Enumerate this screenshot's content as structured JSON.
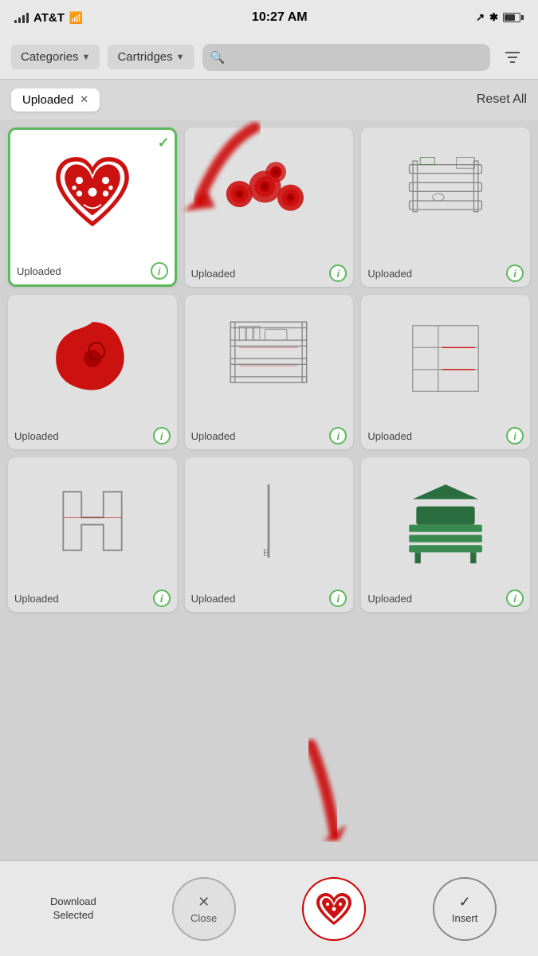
{
  "statusBar": {
    "carrier": "AT&T",
    "time": "10:27 AM",
    "battery": 70
  },
  "navBar": {
    "categoriesLabel": "Categories",
    "cartridgesLabel": "Cartridges",
    "searchPlaceholder": "Search"
  },
  "filterBar": {
    "filterTag": "Uploaded",
    "resetLabel": "Reset All"
  },
  "cards": [
    {
      "id": 1,
      "label": "Uploaded",
      "selected": true,
      "type": "heart"
    },
    {
      "id": 2,
      "label": "Uploaded",
      "selected": false,
      "type": "spirals"
    },
    {
      "id": 3,
      "label": "Uploaded",
      "selected": false,
      "type": "shelf1"
    },
    {
      "id": 4,
      "label": "Uploaded",
      "selected": false,
      "type": "flower-scroll"
    },
    {
      "id": 5,
      "label": "Uploaded",
      "selected": false,
      "type": "shelf2"
    },
    {
      "id": 6,
      "label": "Uploaded",
      "selected": false,
      "type": "shelf3"
    },
    {
      "id": 7,
      "label": "Uploaded",
      "selected": false,
      "type": "shelf4"
    },
    {
      "id": 8,
      "label": "Uploaded",
      "selected": false,
      "type": "stem"
    },
    {
      "id": 9,
      "label": "Uploaded",
      "selected": false,
      "type": "bench"
    }
  ],
  "bottomBar": {
    "downloadLabel": "Download Selected",
    "closeLabel": "Close",
    "insertLabel": "Insert"
  }
}
